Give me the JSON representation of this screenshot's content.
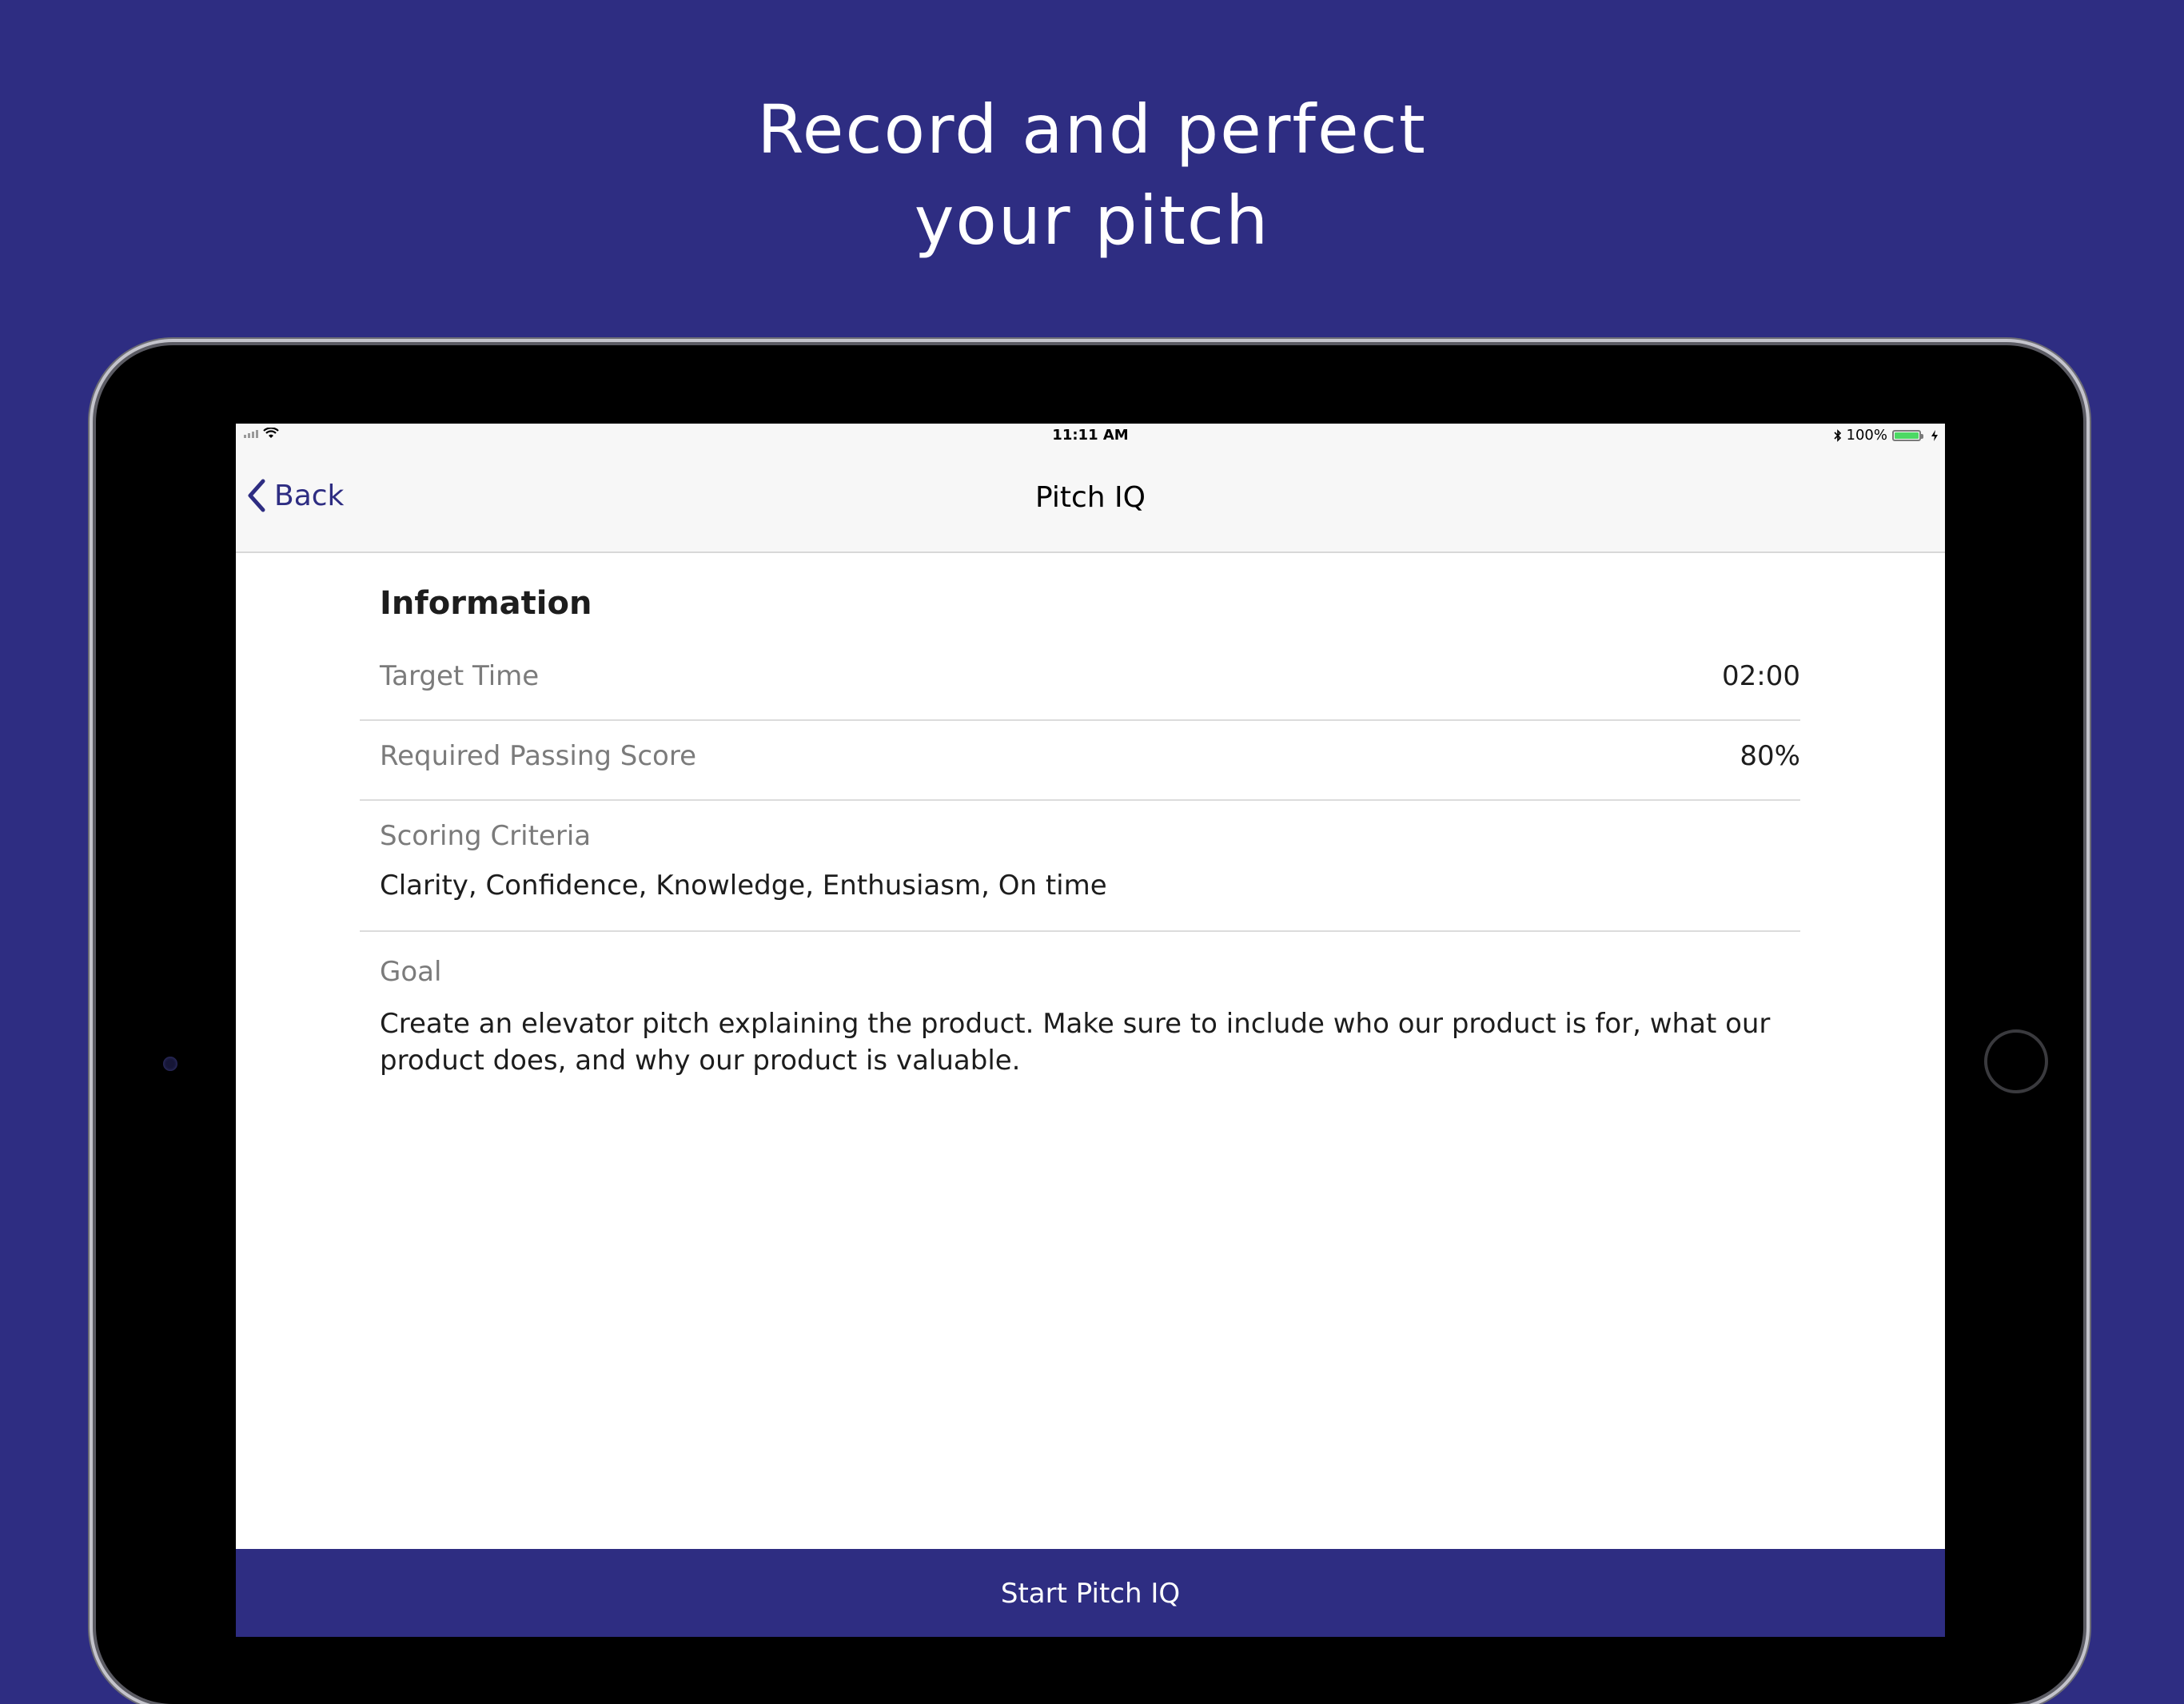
{
  "headline": {
    "line1": "Record and perfect",
    "line2": "your pitch"
  },
  "status_bar": {
    "time": "11:11 AM",
    "battery_percent": "100%",
    "battery_level": 1.0,
    "icons": [
      "signal-icon",
      "wifi-icon",
      "bluetooth-icon",
      "battery-icon",
      "charging-icon"
    ]
  },
  "nav": {
    "back_label": "Back",
    "title": "Pitch IQ"
  },
  "info": {
    "section_title": "Information",
    "target_time_label": "Target Time",
    "target_time_value": "02:00",
    "passing_score_label": "Required Passing Score",
    "passing_score_value": "80%",
    "criteria_label": "Scoring Criteria",
    "criteria_value": "Clarity, Confidence, Knowledge, Enthusiasm, On time",
    "goal_label": "Goal",
    "goal_text": "Create an elevator pitch explaining the product. Make sure to include who our product is for, what our product does, and why our product is valuable."
  },
  "footer": {
    "start_label": "Start Pitch IQ"
  },
  "colors": {
    "brand": "#2e2d82",
    "background": "#2e2d82",
    "label_gray": "#7b7b7b",
    "battery_green": "#4cd964"
  }
}
